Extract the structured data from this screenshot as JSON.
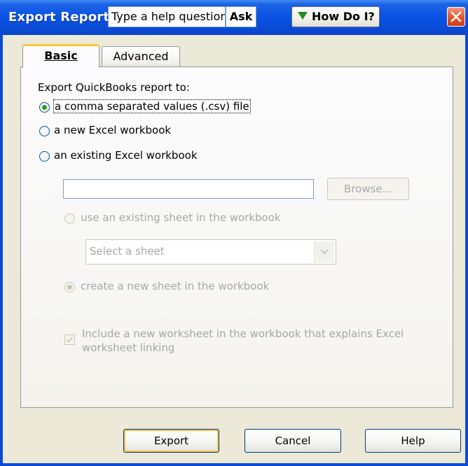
{
  "window": {
    "title": "Export Report"
  },
  "titlebar": {
    "help_input_value": "Type a help question",
    "ask_label": "Ask",
    "how_do_label": "How Do I?"
  },
  "tabs": [
    {
      "label": "Basic",
      "selected": true
    },
    {
      "label": "Advanced",
      "selected": false
    }
  ],
  "basic": {
    "heading": "Export QuickBooks report to:",
    "options": [
      {
        "label": "a comma separated values (.csv) file",
        "checked": true
      },
      {
        "label": "a new Excel workbook",
        "checked": false
      },
      {
        "label": "an existing Excel workbook",
        "checked": false
      }
    ],
    "workbook_path_value": "",
    "browse_label": "Browse...",
    "use_existing_sheet_label": "use an existing sheet in the workbook",
    "sheet_select_value": "Select a sheet",
    "create_new_sheet_label": "create a new sheet in the workbook",
    "include_worksheet_label_line1": "Include a new worksheet in the workbook that explains Excel",
    "include_worksheet_label_line2": "worksheet linking",
    "include_worksheet_checked": true
  },
  "footer": {
    "export_label": "Export",
    "cancel_label": "Cancel",
    "help_label": "Help"
  },
  "colors": {
    "titlebar": "#0A4BD6",
    "dialog_bg": "#ECE9D8",
    "radio_selected": "#21A121",
    "tab_highlight": "#FFC83C"
  }
}
